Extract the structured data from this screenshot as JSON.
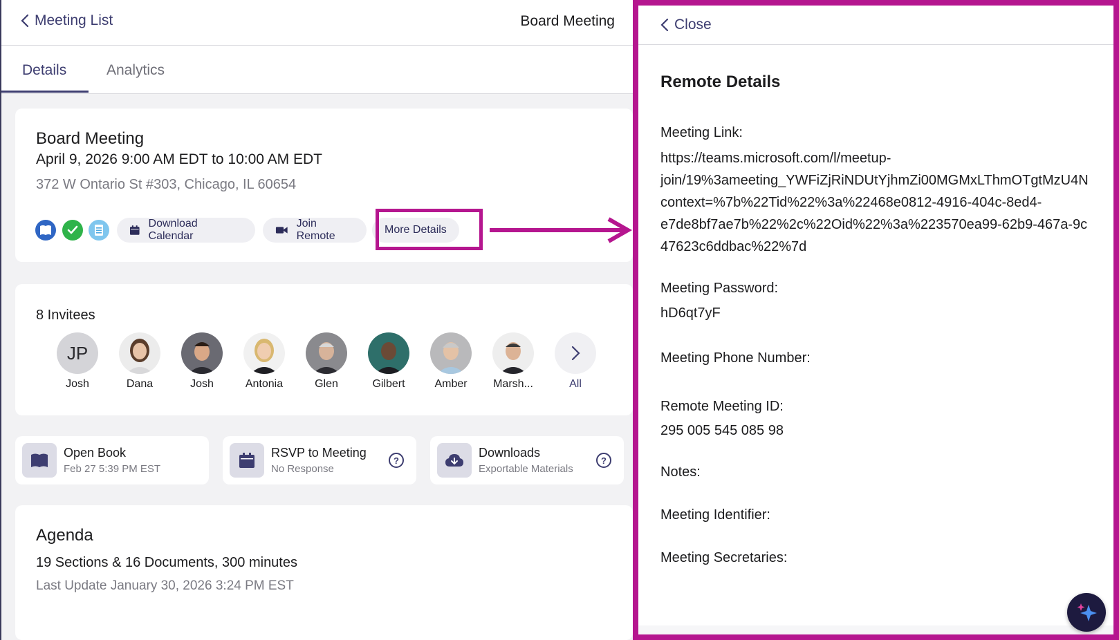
{
  "header": {
    "back_label": "Meeting List",
    "title": "Board Meeting"
  },
  "tabs": [
    {
      "label": "Details",
      "active": true
    },
    {
      "label": "Analytics",
      "active": false
    }
  ],
  "meeting": {
    "title": "Board Meeting",
    "date": "April 9, 2026 9:00 AM EDT to 10:00 AM EDT",
    "location": "372 W Ontario St #303, Chicago, IL 60654",
    "status_icons": [
      "book-icon",
      "check-circle-icon",
      "document-icon"
    ],
    "buttons": {
      "download_calendar": "Download Calendar",
      "join_remote": "Join Remote",
      "more_details": "More Details"
    }
  },
  "invitees": {
    "title": "8 Invitees",
    "people": [
      {
        "name": "Josh",
        "initials": "JP"
      },
      {
        "name": "Dana"
      },
      {
        "name": "Josh"
      },
      {
        "name": "Antonia"
      },
      {
        "name": "Glen"
      },
      {
        "name": "Gilbert"
      },
      {
        "name": "Amber"
      },
      {
        "name": "Marsh..."
      }
    ],
    "all_label": "All"
  },
  "quick_cards": [
    {
      "title": "Open Book",
      "subtitle": "Feb 27 5:39 PM EST",
      "icon": "open-book-icon"
    },
    {
      "title": "RSVP to Meeting",
      "subtitle": "No Response",
      "icon": "calendar-icon"
    },
    {
      "title": "Downloads",
      "subtitle": "Exportable Materials",
      "icon": "cloud-download-icon"
    }
  ],
  "agenda": {
    "title": "Agenda",
    "summary": "19 Sections & 16 Documents, 300 minutes",
    "updated": "Last Update January 30, 2026 3:24 PM EST"
  },
  "remote_panel": {
    "close_label": "Close",
    "title": "Remote Details",
    "meeting_link_label": "Meeting Link:",
    "meeting_link_lines": [
      "https://teams.microsoft.com/l/meetup-",
      "join/19%3ameeting_YWFiZjRiNDUtYjhmZi00MGMxLThmOTgtMzU4N",
      "context=%7b%22Tid%22%3a%22468e0812-4916-404c-8ed4-",
      "e7de8bf7ae7b%22%2c%22Oid%22%3a%223570ea99-62b9-467a-9c",
      "47623c6ddbac%22%7d"
    ],
    "password_label": "Meeting Password:",
    "password": "hD6qt7yF",
    "phone_label": "Meeting Phone Number:",
    "remote_id_label": "Remote Meeting ID:",
    "remote_id": "295 005 545 085 98",
    "notes_label": "Notes:",
    "identifier_label": "Meeting Identifier:",
    "secretaries_label": "Meeting Secretaries:"
  },
  "colors": {
    "accent": "#3d3d70",
    "highlight": "#b5168f",
    "green": "#2fb34a",
    "blue": "#2f66c4",
    "teal": "#4ba8e0"
  }
}
